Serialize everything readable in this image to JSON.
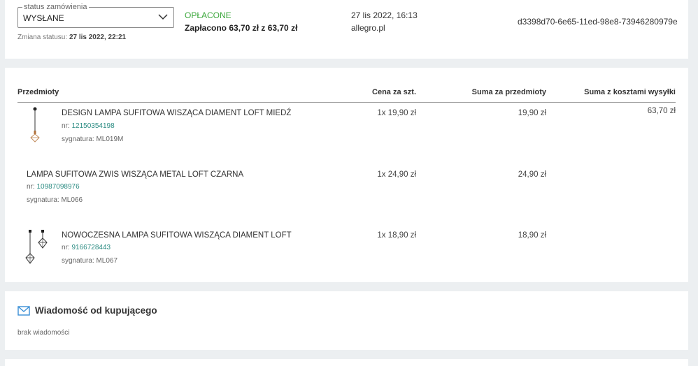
{
  "order": {
    "status_legend": "status zamówienia",
    "status_value": "WYSŁANE",
    "status_change_label": "Zmiana statusu:",
    "status_change_date": "27 lis 2022, 22:21",
    "payment_status": "OPŁACONE",
    "payment_amount": "Zapłacono 63,70 zł z 63,70 zł",
    "date": "27 lis 2022, 16:13",
    "marketplace": "allegro.pl",
    "id": "d3398d70-6e65-11ed-98e8-73946280979e"
  },
  "items_table": {
    "headers": {
      "items": "Przedmioty",
      "unit_price": "Cena za szt.",
      "items_total": "Suma za przedmioty",
      "total_with_shipping": "Suma z kosztami wysyłki"
    },
    "total_with_shipping": "63,70 zł",
    "rows": [
      {
        "name": "DESIGN LAMPA SUFITOWA WISZĄCA DIAMENT LOFT MIEDŹ",
        "nr_label": "nr:",
        "nr": "12150354198",
        "signature": "sygnatura: ML019M",
        "unit_price": "1x 19,90 zł",
        "sum": "19,90 zł",
        "thumb": "copper-diamond-pendant-lamp"
      },
      {
        "name": "LAMPA SUFITOWA ZWIS WISZĄCA METAL LOFT CZARNA",
        "nr_label": "nr:",
        "nr": "10987098976",
        "signature": "sygnatura: ML066",
        "unit_price": "1x 24,90 zł",
        "sum": "24,90 zł",
        "thumb": null
      },
      {
        "name": "NOWOCZESNA LAMPA SUFITOWA WISZĄCA DIAMENT LOFT",
        "nr_label": "nr:",
        "nr": "9166728443",
        "signature": "sygnatura: ML067",
        "unit_price": "1x 18,90 zł",
        "sum": "18,90 zł",
        "thumb": "black-diamond-pendant-lamps"
      }
    ]
  },
  "message": {
    "icon": "envelope-icon",
    "title": "Wiadomość od kupującego",
    "body": "brak wiadomości"
  },
  "colors": {
    "paid_green": "#3ea83e",
    "link_teal": "#2c8c83",
    "page_bg": "#eceff1",
    "accent_blue": "#3a8fd6"
  }
}
